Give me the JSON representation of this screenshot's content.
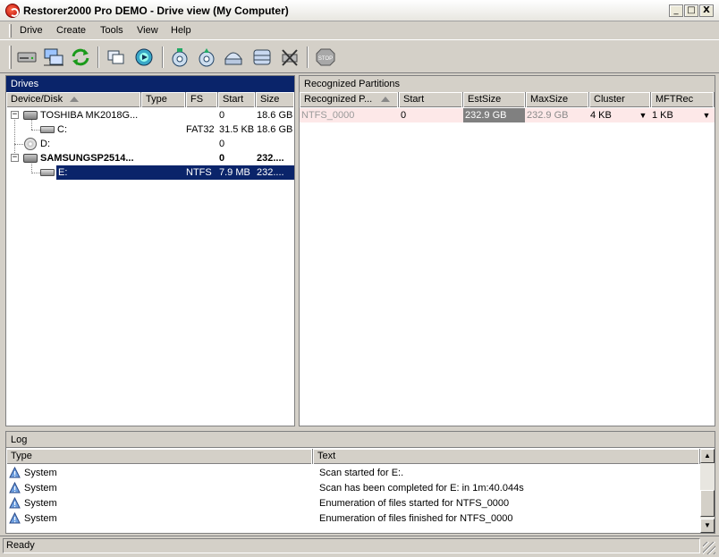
{
  "window": {
    "title": "Restorer2000 Pro DEMO - Drive view (My Computer)",
    "buttons": {
      "minimize": "_",
      "maximize": "□",
      "close": "X"
    }
  },
  "menu": [
    "Drive",
    "Create",
    "Tools",
    "View",
    "Help"
  ],
  "toolbar": {
    "icons": [
      "drive-icon",
      "network-drives-icon",
      "refresh-icon",
      "copy-regions-icon",
      "scan-icon",
      "open-file-icon",
      "open-image-icon",
      "create-image-icon",
      "create-region-icon",
      "remove-icon",
      "stop-icon"
    ]
  },
  "drives": {
    "header": "Drives",
    "columns": [
      "Device/Disk",
      "Type",
      "FS",
      "Start",
      "Size"
    ],
    "rows": [
      {
        "name": "TOSHIBA MK2018G...",
        "type": "",
        "fs": "",
        "start": "0",
        "size": "18.6 GB"
      },
      {
        "name": "C:",
        "type": "",
        "fs": "FAT32",
        "start": "31.5 KB",
        "size": "18.6 GB"
      },
      {
        "name": "D:",
        "type": "",
        "fs": "",
        "start": "0",
        "size": ""
      },
      {
        "name": "SAMSUNGSP2514...",
        "type": "",
        "fs": "",
        "start": "0",
        "size": "232...."
      },
      {
        "name": "E:",
        "type": "",
        "fs": "NTFS",
        "start": "7.9 MB",
        "size": "232...."
      }
    ]
  },
  "partitions": {
    "header": "Recognized Partitions",
    "columns": [
      "Recognized P...",
      "Start",
      "EstSize",
      "MaxSize",
      "Cluster",
      "MFTRec"
    ],
    "rows": [
      {
        "name": "NTFS_0000",
        "start": "0",
        "estsize": "232.9 GB",
        "maxsize": "232.9 GB",
        "cluster": "4 KB",
        "mftrec": "1 KB"
      }
    ]
  },
  "log": {
    "header": "Log",
    "columns": [
      "Type",
      "Text"
    ],
    "rows": [
      {
        "type": "System",
        "text": "Scan started for E:."
      },
      {
        "type": "System",
        "text": "Scan has been completed for E: in 1m:40.044s"
      },
      {
        "type": "System",
        "text": "Enumeration of files started for NTFS_0000"
      },
      {
        "type": "System",
        "text": "Enumeration of files finished for NTFS_0000"
      }
    ]
  },
  "status": "Ready",
  "colors": {
    "selection": "#0a246a",
    "partition_row": "#fde8e8",
    "estsize_bg": "#808080"
  }
}
